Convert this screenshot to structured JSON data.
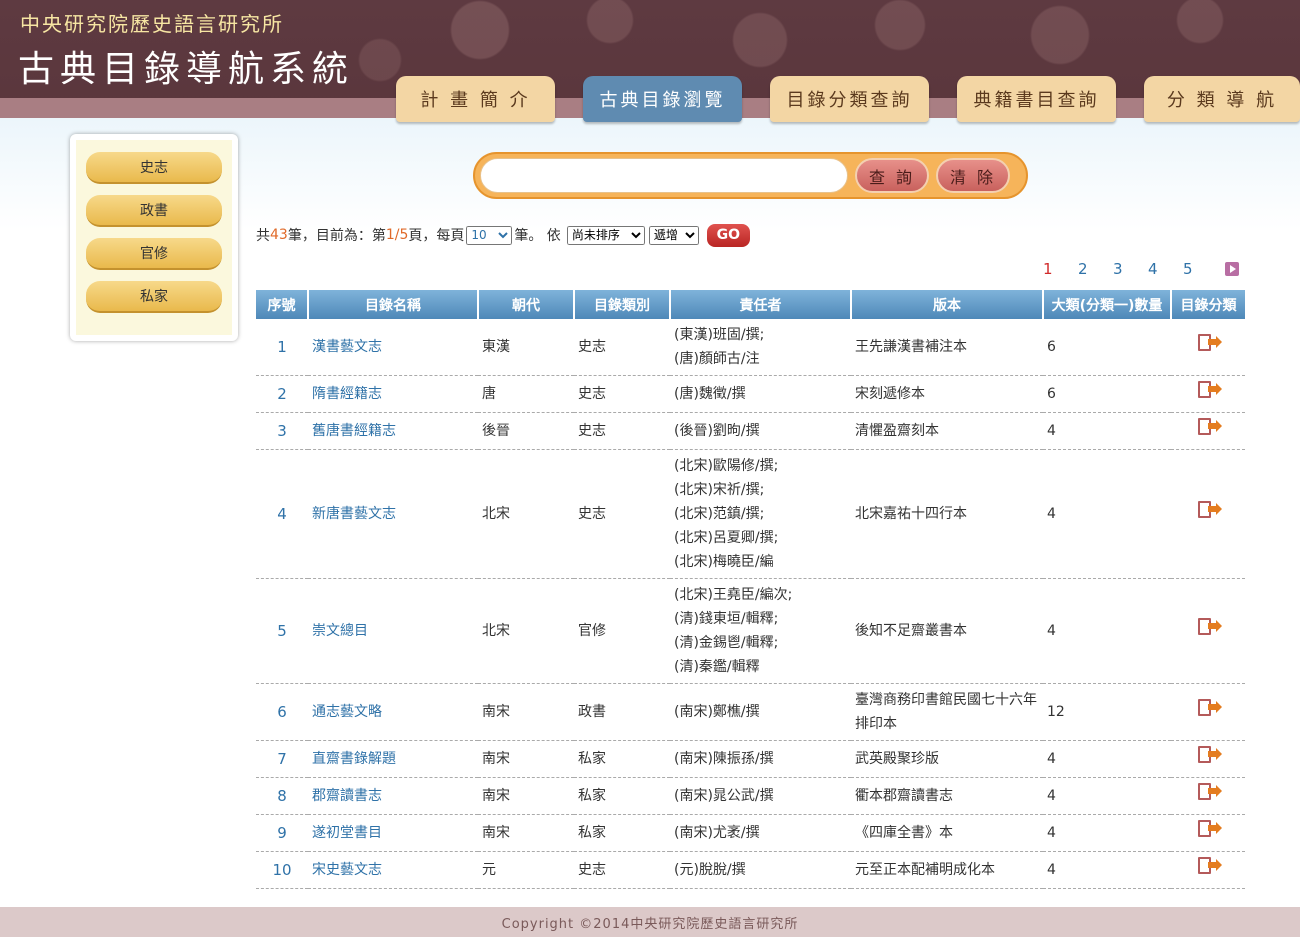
{
  "header": {
    "institute": "中央研究院歷史語言研究所",
    "system_title": "古典目錄導航系統",
    "tabs": [
      "計 畫 簡 介",
      "古典目錄瀏覽",
      "目錄分類查詢",
      "典籍書目查詢",
      "分 類 導 航"
    ]
  },
  "sidebar": {
    "items": [
      "史志",
      "政書",
      "官修",
      "私家"
    ]
  },
  "search": {
    "placeholder": "",
    "query_label": "查 詢",
    "clear_label": "清 除"
  },
  "info": {
    "prefix": "共",
    "total": "43",
    "mid1": "筆，目前為：第",
    "page": "1/5",
    "mid2": "頁，每頁",
    "per_page": "10",
    "mid3": "筆。 依",
    "sort_by": "尚未排序",
    "order": "遞增",
    "go": "GO"
  },
  "pagination": {
    "pages": [
      "1",
      "2",
      "3",
      "4",
      "5"
    ],
    "current": "1"
  },
  "table": {
    "headers": [
      "序號",
      "目錄名稱",
      "朝代",
      "目錄類別",
      "責任者",
      "版本",
      "大類(分類一)數量",
      "目錄分類"
    ],
    "rows": [
      {
        "seq": "1",
        "name": "漢書藝文志",
        "dynasty": "東漢",
        "category": "史志",
        "authors": [
          "(東漢)班固/撰;",
          "(唐)顏師古/注"
        ],
        "edition": "王先謙漢書補注本",
        "count": "6"
      },
      {
        "seq": "2",
        "name": "隋書經籍志",
        "dynasty": "唐",
        "category": "史志",
        "authors": [
          "(唐)魏徵/撰"
        ],
        "edition": "宋刻遞修本",
        "count": "6"
      },
      {
        "seq": "3",
        "name": "舊唐書經籍志",
        "dynasty": "後晉",
        "category": "史志",
        "authors": [
          "(後晉)劉昫/撰"
        ],
        "edition": "清懼盈齋刻本",
        "count": "4"
      },
      {
        "seq": "4",
        "name": "新唐書藝文志",
        "dynasty": "北宋",
        "category": "史志",
        "authors": [
          "(北宋)歐陽修/撰;",
          "(北宋)宋祈/撰;",
          "(北宋)范鎮/撰;",
          "(北宋)呂夏卿/撰;",
          "(北宋)梅曉臣/編"
        ],
        "edition": "北宋嘉祐十四行本",
        "count": "4"
      },
      {
        "seq": "5",
        "name": "崇文總目",
        "dynasty": "北宋",
        "category": "官修",
        "authors": [
          "(北宋)王堯臣/編次;",
          "(清)錢東垣/輯釋;",
          "(清)金錫鬯/輯釋;",
          "(清)秦鑑/輯釋"
        ],
        "edition": "後知不足齋叢書本",
        "count": "4"
      },
      {
        "seq": "6",
        "name": "通志藝文略",
        "dynasty": "南宋",
        "category": "政書",
        "authors": [
          "(南宋)鄭樵/撰"
        ],
        "edition": "臺灣商務印書館民國七十六年排印本",
        "count": "12"
      },
      {
        "seq": "7",
        "name": "直齋書錄解題",
        "dynasty": "南宋",
        "category": "私家",
        "authors": [
          "(南宋)陳振孫/撰"
        ],
        "edition": "武英殿聚珍版",
        "count": "4"
      },
      {
        "seq": "8",
        "name": "郡齋讀書志",
        "dynasty": "南宋",
        "category": "私家",
        "authors": [
          "(南宋)晁公武/撰"
        ],
        "edition": "衢本郡齋讀書志",
        "count": "4"
      },
      {
        "seq": "9",
        "name": "遂初堂書目",
        "dynasty": "南宋",
        "category": "私家",
        "authors": [
          "(南宋)尤袤/撰"
        ],
        "edition": "《四庫全書》本",
        "count": "4"
      },
      {
        "seq": "10",
        "name": "宋史藝文志",
        "dynasty": "元",
        "category": "史志",
        "authors": [
          "(元)脫脫/撰"
        ],
        "edition": "元至正本配補明成化本",
        "count": "4"
      }
    ]
  },
  "footer": {
    "copyright": "Copyright ©2014中央研究院歷史語言研究所"
  },
  "colors": {
    "header_bg": "#5e3a41",
    "tab_bg": "#f3d6a4",
    "tab_active": "#5f8bb1",
    "link": "#2f72a8",
    "accent": "#e06a2a"
  }
}
